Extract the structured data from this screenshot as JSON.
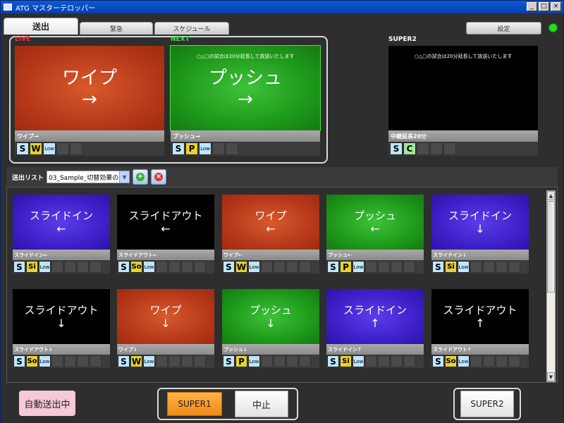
{
  "window": {
    "title": "ATG マスターテロッパー",
    "buttons": [
      "_",
      "□",
      "×"
    ]
  },
  "tabs": [
    {
      "label": "送出",
      "active": true
    },
    {
      "label": "緊急",
      "active": false
    },
    {
      "label": "スケジュール",
      "active": false
    }
  ],
  "settings_label": "設定",
  "status_color": "#22dd22",
  "monitors": {
    "live": {
      "label": "LIVE",
      "label_color": "#ff3030",
      "color": "red",
      "title": "ワイプ",
      "arrow": "→",
      "caption": "",
      "name": "ワイプ→",
      "icons": [
        {
          "t": "S",
          "k": "s"
        },
        {
          "t": "W",
          "k": "w"
        },
        {
          "t": "Low",
          "k": "low"
        },
        {
          "t": "",
          "k": "empty"
        },
        {
          "t": "",
          "k": "empty"
        }
      ]
    },
    "next": {
      "label": "NEXT",
      "label_color": "#3ee83e",
      "color": "green",
      "title": "プッシュ",
      "arrow": "→",
      "caption": "○△□の試合は20分延長して放送いたします",
      "name": "プッシュ→",
      "icons": [
        {
          "t": "S",
          "k": "s"
        },
        {
          "t": "P",
          "k": "p"
        },
        {
          "t": "Low",
          "k": "low"
        },
        {
          "t": "",
          "k": "empty"
        },
        {
          "t": "",
          "k": "empty"
        }
      ]
    },
    "super2": {
      "label": "SUPER2",
      "label_color": "#ffffff",
      "color": "black",
      "title": "",
      "arrow": "",
      "caption": "○△□の試合は20分延長して放送いたします",
      "name": "中継延長20分",
      "icons": [
        {
          "t": "S",
          "k": "s"
        },
        {
          "t": "C",
          "k": "c"
        },
        {
          "t": "",
          "k": "empty"
        },
        {
          "t": "",
          "k": "empty"
        },
        {
          "t": "",
          "k": "empty"
        }
      ]
    }
  },
  "send_list": {
    "label": "送出リスト",
    "selected": "03_Sample_切替効果の",
    "add_icon": "add-icon",
    "delete_icon": "delete-icon"
  },
  "cards": [
    {
      "color": "purple",
      "title": "スライドイン",
      "arrow": "←",
      "name": "スライドイン←",
      "effect": "Si"
    },
    {
      "color": "black",
      "title": "スライドアウト",
      "arrow": "←",
      "name": "スライドアウト←",
      "effect": "So"
    },
    {
      "color": "red",
      "title": "ワイプ",
      "arrow": "←",
      "name": "ワイプ←",
      "effect": "W"
    },
    {
      "color": "green",
      "title": "プッシュ",
      "arrow": "←",
      "name": "プッシュ←",
      "effect": "P"
    },
    {
      "color": "purple",
      "title": "スライドイン",
      "arrow": "↓",
      "name": "スライドイン↓",
      "effect": "Si"
    },
    {
      "color": "black",
      "title": "スライドアウト",
      "arrow": "↓",
      "name": "スライドアウト↓",
      "effect": "So"
    },
    {
      "color": "red",
      "title": "ワイプ",
      "arrow": "↓",
      "name": "ワイプ↓",
      "effect": "W"
    },
    {
      "color": "green",
      "title": "プッシュ",
      "arrow": "↓",
      "name": "プッシュ↓",
      "effect": "P"
    },
    {
      "color": "purple",
      "title": "スライドイン",
      "arrow": "↑",
      "name": "スライドイン↑",
      "effect": "Si"
    },
    {
      "color": "black",
      "title": "スライドアウト",
      "arrow": "↑",
      "name": "スライドアウト↑",
      "effect": "So"
    }
  ],
  "bottom": {
    "auto_label": "自動送出中",
    "super1_label": "SUPER1",
    "stop_label": "中止",
    "super2_label": "SUPER2"
  }
}
